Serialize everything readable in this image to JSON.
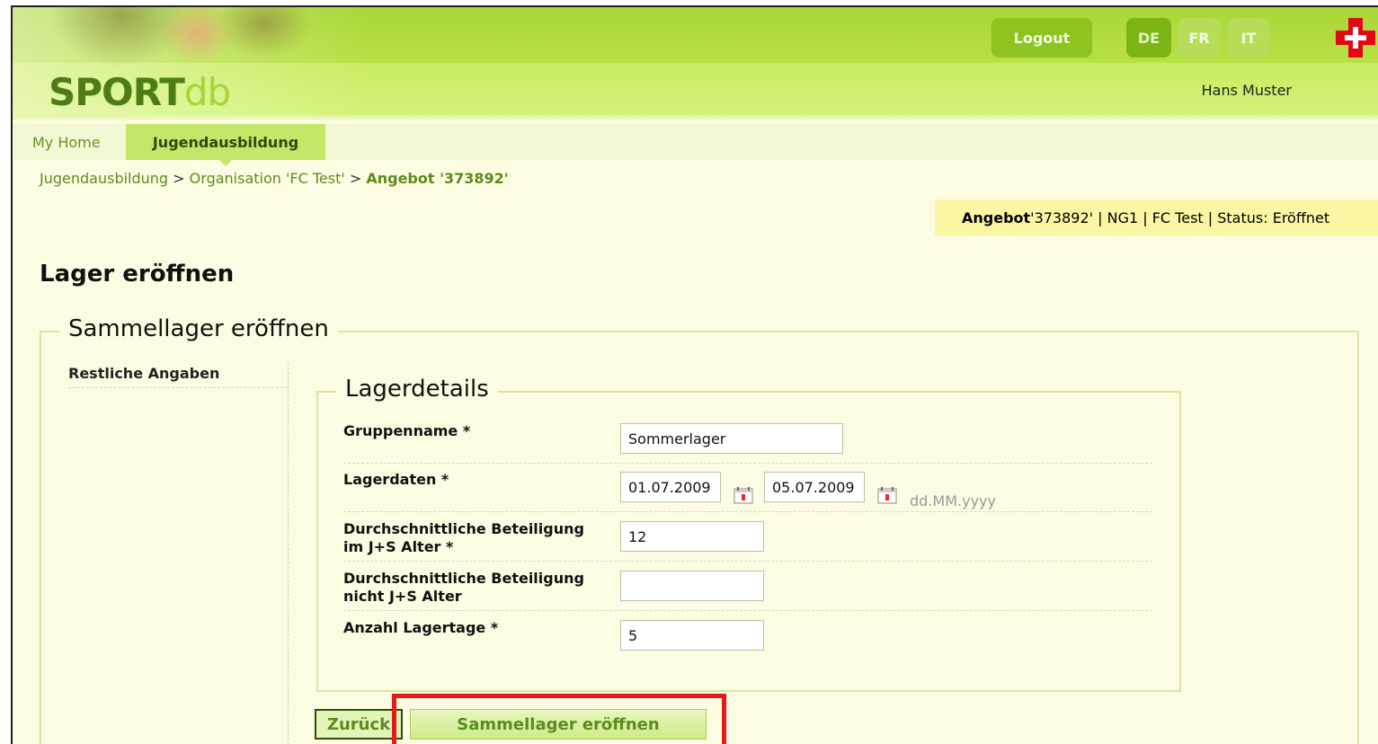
{
  "header": {
    "logo_sport": "SPORT",
    "logo_db": "db",
    "logout_label": "Logout",
    "languages": [
      "DE",
      "FR",
      "IT"
    ],
    "user_name": "Hans Muster"
  },
  "nav": {
    "tabs": [
      {
        "label": "My Home",
        "active": false
      },
      {
        "label": "Jugendausbildung",
        "active": true
      }
    ]
  },
  "breadcrumb": {
    "items": [
      "Jugendausbildung",
      "Organisation 'FC Test'",
      "Angebot '373892'"
    ],
    "separator": ">"
  },
  "status_bar": {
    "label": "Angebot",
    "text": " '373892' | NG1 | FC Test | Status: Eröffnet"
  },
  "page_title": "Lager eröffnen",
  "outer_section": {
    "legend": "Sammellager eröffnen",
    "side_item": "Restliche Angaben"
  },
  "lagerdetails": {
    "legend": "Lagerdetails",
    "fields": [
      {
        "label_line1": "Gruppenname *",
        "label_line2": "",
        "value": "Sommerlager"
      },
      {
        "label_line1": "Lagerdaten *",
        "label_line2": "",
        "value_from": "01.07.2009",
        "value_to": "05.07.2009",
        "hint": "dd.MM.yyyy"
      },
      {
        "label_line1": "Durchschnittliche Beteiligung",
        "label_line2": "im J+S Alter *",
        "value": "12"
      },
      {
        "label_line1": "Durchschnittliche Beteiligung",
        "label_line2": "nicht J+S Alter",
        "value": ""
      },
      {
        "label_line1": "Anzahl Lagertage *",
        "label_line2": "",
        "value": "5"
      }
    ]
  },
  "buttons": {
    "back": "Zurück",
    "submit": "Sammellager eröffnen"
  },
  "colors": {
    "brand_green": "#8fc31f",
    "highlight_red": "#e21a1a",
    "status_yellow": "#faf6a3"
  }
}
